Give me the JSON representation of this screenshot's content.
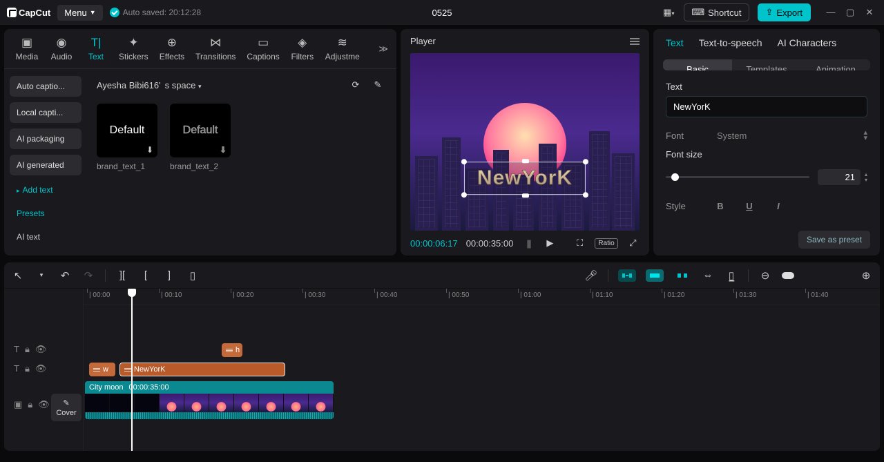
{
  "app": {
    "name": "CapCut",
    "menu": "Menu",
    "autosave": "Auto saved: 20:12:28",
    "project": "0525"
  },
  "titlebar": {
    "shortcut": "Shortcut",
    "export": "Export"
  },
  "tools": {
    "items": [
      {
        "label": "Media",
        "icon": "▣"
      },
      {
        "label": "Audio",
        "icon": "◉"
      },
      {
        "label": "Text",
        "icon": "T|",
        "active": true
      },
      {
        "label": "Stickers",
        "icon": "✦"
      },
      {
        "label": "Effects",
        "icon": "⊕"
      },
      {
        "label": "Transitions",
        "icon": "⋈"
      },
      {
        "label": "Captions",
        "icon": "▭"
      },
      {
        "label": "Filters",
        "icon": "◈"
      },
      {
        "label": "Adjustme",
        "icon": "≋"
      }
    ]
  },
  "sidebar": {
    "buttons": [
      "Auto captio...",
      "Local capti...",
      "AI packaging",
      "AI generated"
    ],
    "links": [
      {
        "t": "Add text",
        "accent": true,
        "marker": true
      },
      {
        "t": "Presets",
        "accent": true
      },
      {
        "t": "AI text"
      }
    ]
  },
  "content": {
    "owner": "Ayesha Bibi616'",
    "space": "s space",
    "presets": [
      {
        "label": "brand_text_1",
        "thumb": "Default"
      },
      {
        "label": "brand_text_2",
        "thumb": "Default"
      }
    ]
  },
  "player": {
    "title": "Player",
    "overlayText": "NewYorK",
    "current": "00:00:06:17",
    "total": "00:00:35:00",
    "ratio": "Ratio"
  },
  "inspector": {
    "tabs": [
      "Text",
      "Text-to-speech",
      "AI Characters"
    ],
    "subtabs": [
      "Basic",
      "Templates",
      "Animation"
    ],
    "text_label": "Text",
    "text_value": "NewYorK",
    "font_label": "Font",
    "font_value": "System",
    "fontsize_label": "Font size",
    "fontsize_value": "21",
    "style_label": "Style",
    "save_preset": "Save as preset"
  },
  "timeline": {
    "ticks": [
      "00:00",
      "00:10",
      "00:20",
      "00:30",
      "00:40",
      "00:50",
      "01:00",
      "01:10",
      "01:20",
      "01:30",
      "01:40"
    ],
    "clip_h": "h",
    "clip_w": "w",
    "clip_newyork": "NewYorK",
    "video_name": "City moon",
    "video_dur": "00:00:35:00",
    "cover": "Cover"
  }
}
